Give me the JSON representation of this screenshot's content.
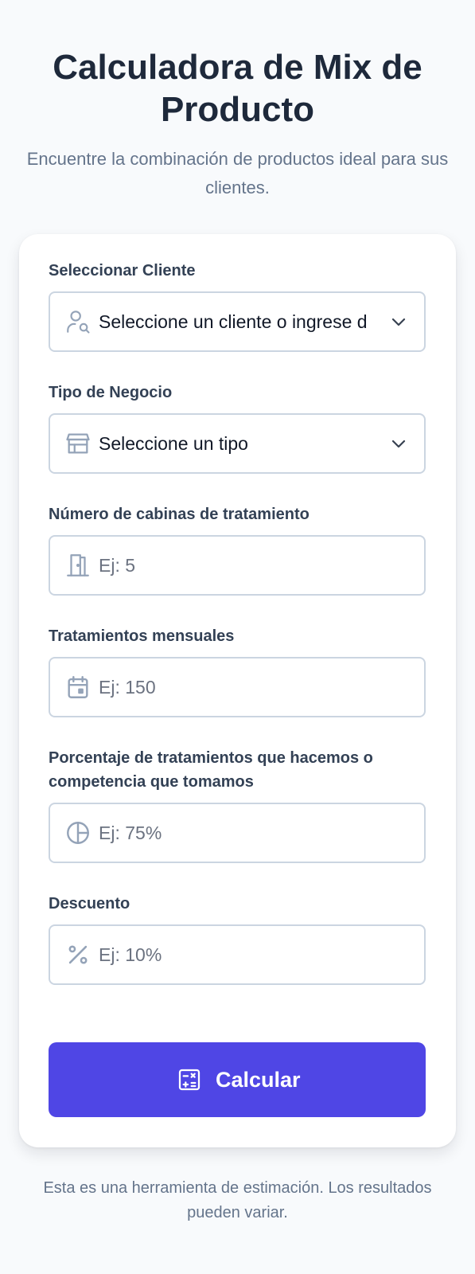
{
  "header": {
    "title": "Calculadora de Mix de Producto",
    "subtitle": "Encuentre la combinación de productos ideal para sus clientes."
  },
  "form": {
    "client": {
      "label": "Seleccionar Cliente",
      "value": "Seleccione un cliente o ingrese d",
      "icon": "user-search-icon"
    },
    "business_type": {
      "label": "Tipo de Negocio",
      "value": "Seleccione un tipo",
      "icon": "store-icon"
    },
    "cabins": {
      "label": "Número de cabinas de tratamiento",
      "placeholder": "Ej: 5",
      "icon": "door-icon"
    },
    "monthly_treatments": {
      "label": "Tratamientos mensuales",
      "placeholder": "Ej: 150",
      "icon": "calendar-icon"
    },
    "percentage": {
      "label": "Porcentaje de tratamientos que hacemos o competencia que tomamos",
      "placeholder": "Ej: 75%",
      "icon": "pie-chart-icon"
    },
    "discount": {
      "label": "Descuento",
      "placeholder": "Ej: 10%",
      "icon": "percent-icon"
    },
    "submit": {
      "label": "Calcular",
      "icon": "calculator-icon"
    }
  },
  "footer": {
    "note": "Esta es una herramienta de estimación. Los resultados pueden variar."
  },
  "colors": {
    "background": "#f8fafc",
    "card": "#ffffff",
    "accent": "#4f46e5",
    "title": "#1e293b",
    "muted": "#64748b",
    "border": "#cbd5e1",
    "icon": "#94a3b8"
  }
}
